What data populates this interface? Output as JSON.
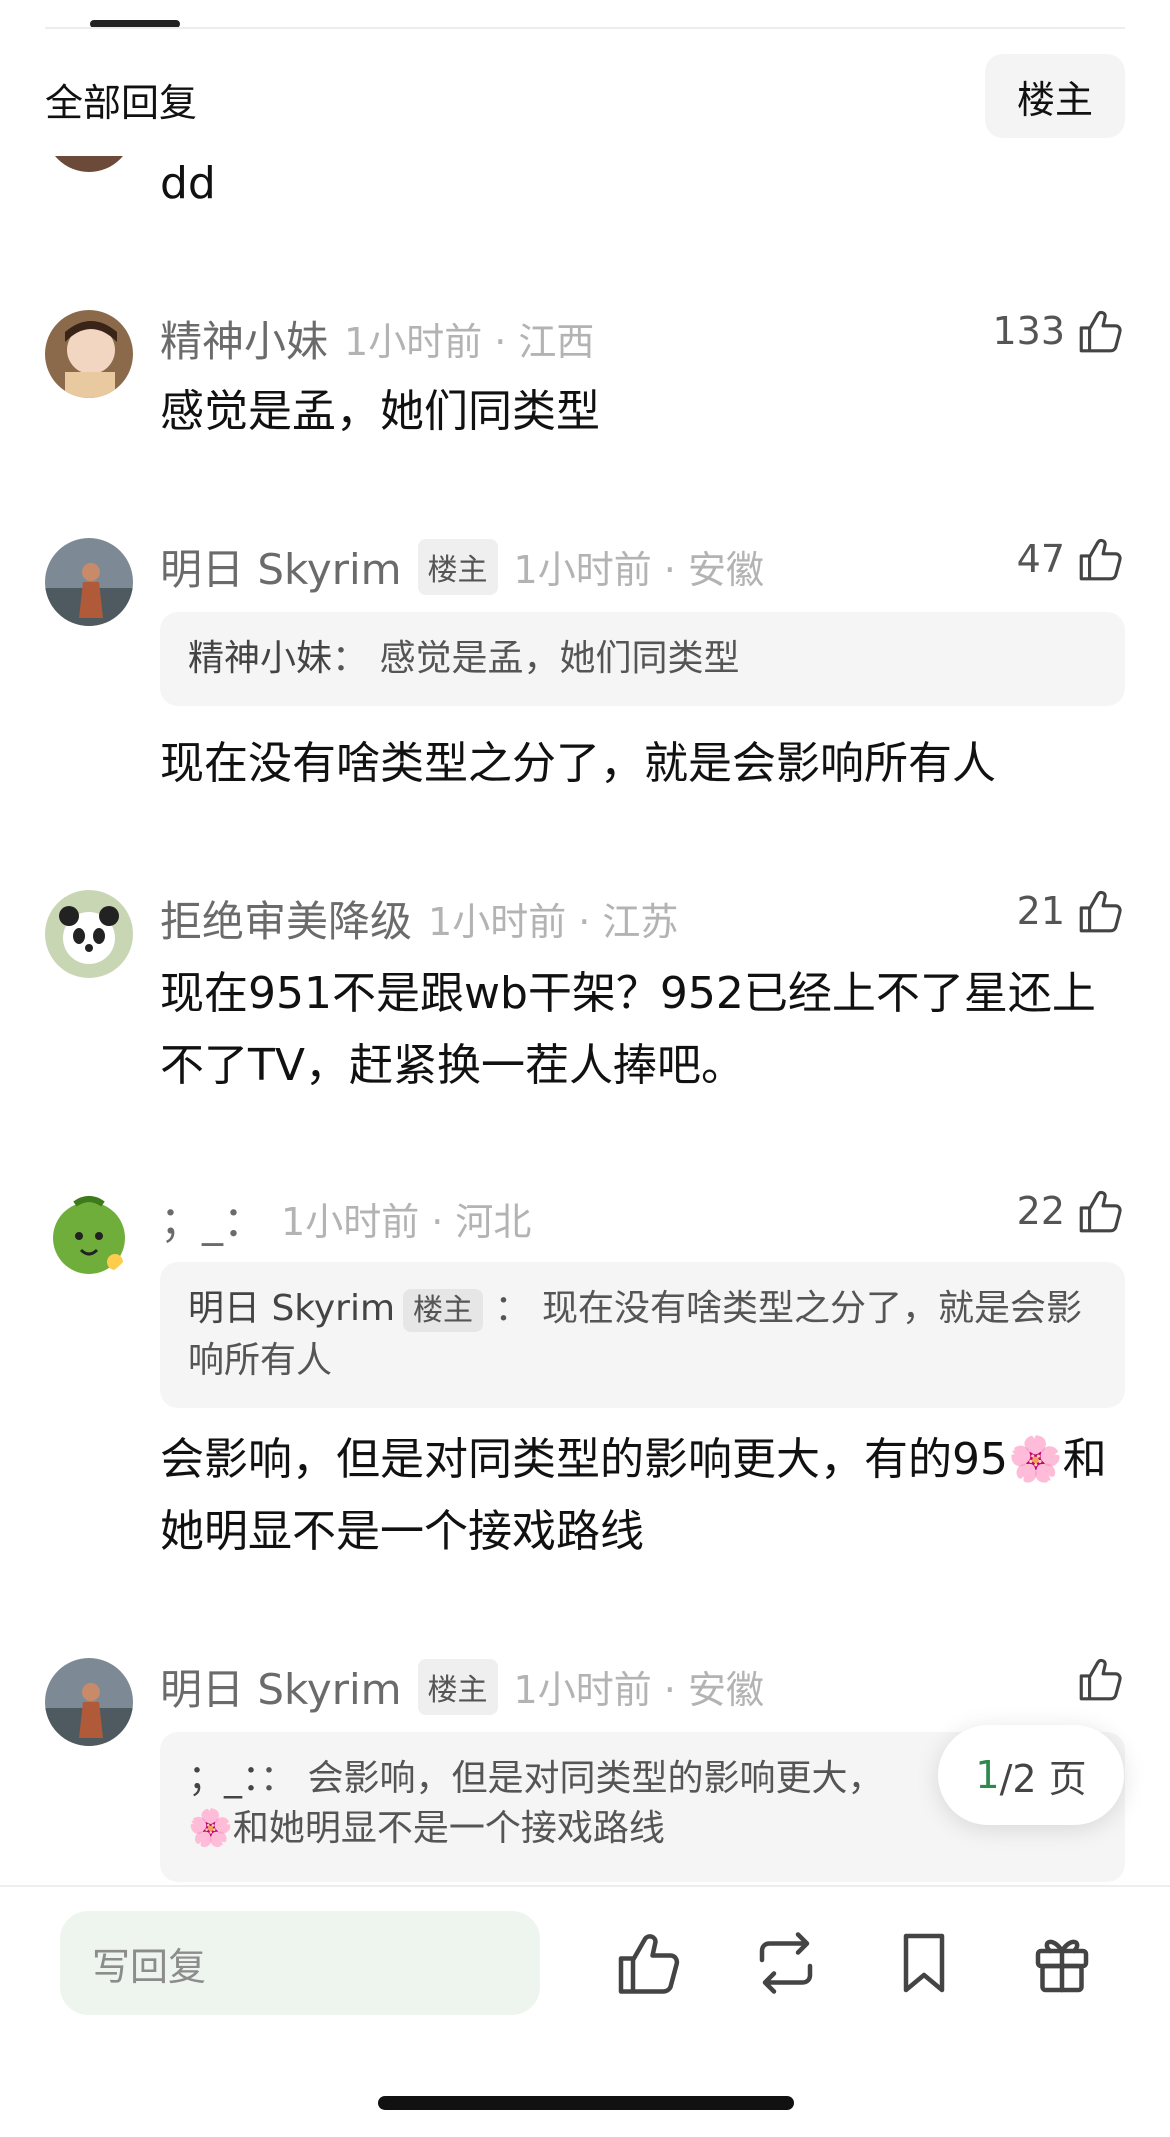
{
  "header": {
    "title": "全部回复",
    "owner_filter": "楼主"
  },
  "partial_comment": {
    "text": "dd"
  },
  "comments": [
    {
      "username": "精神小妹",
      "owner_tag": "",
      "time_location": "1小时前 · 江西",
      "likes": "133",
      "quote": null,
      "text": "感觉是孟，她们同类型"
    },
    {
      "username": "明日 Skyrim",
      "owner_tag": "楼主",
      "time_location": "1小时前 · 安徽",
      "likes": "47",
      "quote": {
        "author": "精神小妹",
        "author_tag": "",
        "separator": "：",
        "text": "感觉是孟，她们同类型"
      },
      "text": "现在没有啥类型之分了，就是会影响所有人"
    },
    {
      "username": "拒绝审美降级",
      "owner_tag": "",
      "time_location": "1小时前 · 江苏",
      "likes": "21",
      "quote": null,
      "text": "现在951不是跟wb干架？952已经上不了星还上不了TV，赶紧换一茬人捧吧。"
    },
    {
      "username": "；_：",
      "owner_tag": "",
      "time_location": "1小时前 · 河北",
      "likes": "22",
      "quote": {
        "author": "明日 Skyrim",
        "author_tag": "楼主",
        "separator": "：",
        "text": "现在没有啥类型之分了，就是会影响所有人"
      },
      "text_before": "会影响，但是对同类型的影响更大，有的95",
      "emoji": "🌸",
      "text_after": "和她明显不是一个接戏路线"
    },
    {
      "username": "明日 Skyrim",
      "owner_tag": "楼主",
      "time_location": "1小时前 · 安徽",
      "likes": "",
      "quote": {
        "author": "；_：",
        "author_tag": "",
        "separator": "：",
        "text_before": "会影响，但是对同类型的影响更大，",
        "emoji": "🌸",
        "text_after": "和她明显不是一个接戏路线"
      }
    }
  ],
  "pagination": {
    "current": "1",
    "total_text": "/2 页"
  },
  "bottom_bar": {
    "reply_placeholder": "写回复"
  },
  "icons": [
    "thumb-up-icon",
    "repost-icon",
    "bookmark-icon",
    "gift-icon"
  ],
  "colors": {
    "accent": "#2d8a4e",
    "meta": "#b3b3b3",
    "quote_bg": "#f5f5f5"
  }
}
